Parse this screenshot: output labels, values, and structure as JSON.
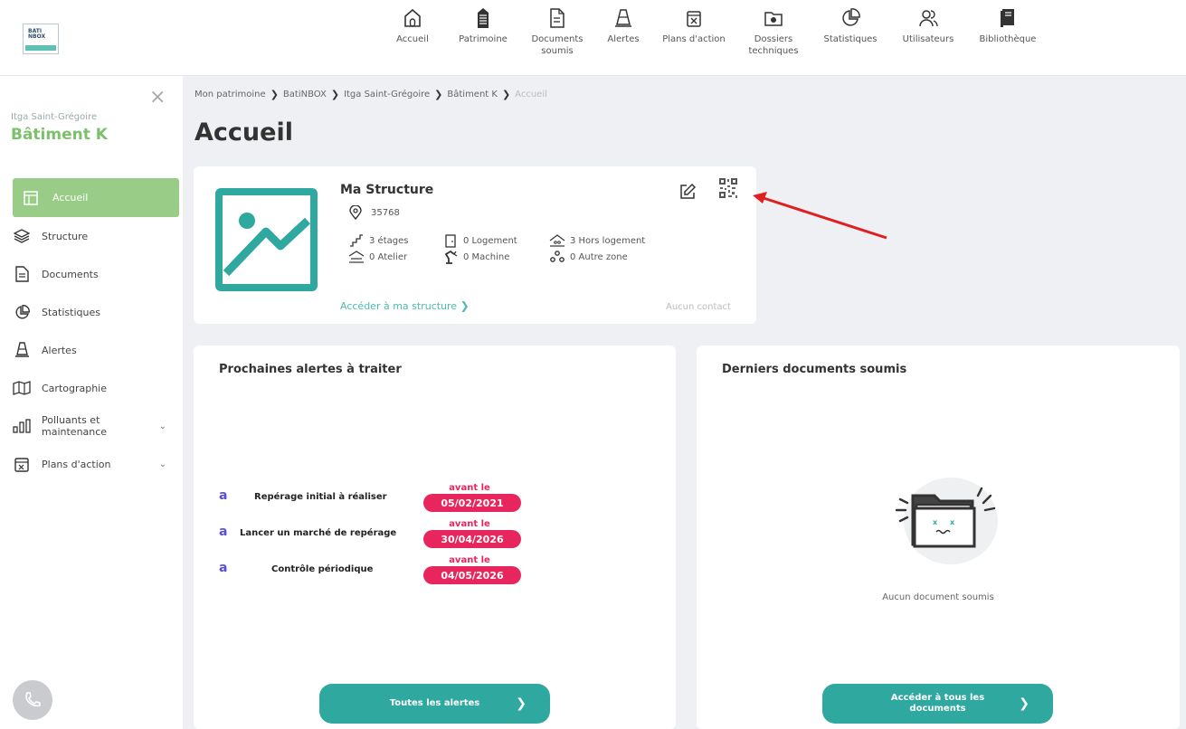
{
  "logo": {
    "text": "BATI\nNBOX"
  },
  "nav": [
    {
      "label": "Accueil",
      "icon": "home-icon"
    },
    {
      "label": "Patrimoine",
      "icon": "building-icon"
    },
    {
      "label": "Documents soumis",
      "icon": "document-icon"
    },
    {
      "label": "Alertes",
      "icon": "cone-icon"
    },
    {
      "label": "Plans d'action",
      "icon": "calendar-x-icon"
    },
    {
      "label": "Dossiers techniques",
      "icon": "folder-icon"
    },
    {
      "label": "Statistiques",
      "icon": "pie-chart-icon"
    },
    {
      "label": "Utilisateurs",
      "icon": "users-icon"
    },
    {
      "label": "Bibliothèque",
      "icon": "library-icon"
    }
  ],
  "sidebar": {
    "subtitle": "Itga Saint-Grégoire",
    "title": "Bâtiment K",
    "items": [
      {
        "label": "Accueil",
        "icon": "layout-icon",
        "active": true
      },
      {
        "label": "Structure",
        "icon": "layers-icon"
      },
      {
        "label": "Documents",
        "icon": "document-icon"
      },
      {
        "label": "Statistiques",
        "icon": "pie-chart-icon"
      },
      {
        "label": "Alertes",
        "icon": "cone-icon"
      },
      {
        "label": "Cartographie",
        "icon": "map-icon"
      },
      {
        "label": "Polluants et maintenance",
        "icon": "bar-chart-icon",
        "expandable": true
      },
      {
        "label": "Plans d'action",
        "icon": "calendar-x-icon",
        "expandable": true
      }
    ]
  },
  "breadcrumb": [
    "Mon patrimoine",
    "BatiNBOX",
    "Itga Saint-Grégoire",
    "Bâtiment K",
    "Accueil"
  ],
  "page_title": "Accueil",
  "structure": {
    "name": "Ma Structure",
    "address": "35768",
    "stats": [
      {
        "label": "3 étages",
        "icon": "stairs-icon"
      },
      {
        "label": "0 Logement",
        "icon": "door-icon"
      },
      {
        "label": "3 Hors logement",
        "icon": "roof-icon"
      },
      {
        "label": "0 Atelier",
        "icon": "workshop-icon"
      },
      {
        "label": "0 Machine",
        "icon": "robot-arm-icon"
      },
      {
        "label": "0 Autre zone",
        "icon": "zones-icon"
      }
    ],
    "link": "Accéder à ma structure",
    "contact": "Aucun contact"
  },
  "alerts_panel": {
    "title": "Prochaines alertes à traiter",
    "before_label": "avant le",
    "items": [
      {
        "marker": "a",
        "label": "Repérage initial à réaliser",
        "date": "05/02/2021"
      },
      {
        "marker": "a",
        "label": "Lancer un marché de repérage",
        "date": "30/04/2026"
      },
      {
        "marker": "a",
        "label": "Contrôle périodique",
        "date": "04/05/2026"
      }
    ],
    "button": "Toutes les alertes"
  },
  "docs_panel": {
    "title": "Derniers documents soumis",
    "empty": "Aucun document soumis",
    "button": "Accéder à tous les documents"
  },
  "colors": {
    "accent": "#2fa8a0",
    "active": "#99cd87",
    "alert": "#e8265e",
    "marker": "#5a4fcf",
    "annotation": "#e02020"
  }
}
